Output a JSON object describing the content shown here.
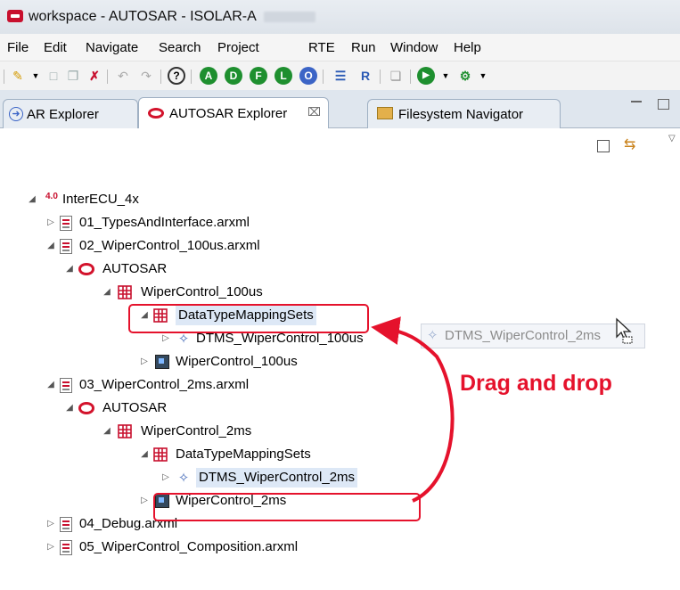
{
  "window": {
    "title": "workspace - AUTOSAR - ISOLAR-A"
  },
  "menu": [
    "File",
    "Edit",
    "Navigate",
    "Search",
    "Project",
    "RTE",
    "Run",
    "Window",
    "Help"
  ],
  "tabs": [
    {
      "label": "AR Explorer"
    },
    {
      "label": "AUTOSAR Explorer"
    },
    {
      "label": "Filesystem Navigator"
    }
  ],
  "toolbar_letters": [
    "A",
    "D",
    "F",
    "L",
    "O"
  ],
  "tree": [
    {
      "label": "InterECU_4x"
    },
    {
      "label": "01_TypesAndInterface.arxml"
    },
    {
      "label": "02_WiperControl_100us.arxml"
    },
    {
      "label": "AUTOSAR"
    },
    {
      "label": "WiperControl_100us"
    },
    {
      "label": "DataTypeMappingSets"
    },
    {
      "label": "DTMS_WiperControl_100us"
    },
    {
      "label": "WiperControl_100us"
    },
    {
      "label": "03_WiperControl_2ms.arxml"
    },
    {
      "label": "AUTOSAR"
    },
    {
      "label": "WiperControl_2ms"
    },
    {
      "label": "DataTypeMappingSets"
    },
    {
      "label": "DTMS_WiperControl_2ms"
    },
    {
      "label": "WiperControl_2ms"
    },
    {
      "label": "04_Debug.arxml"
    },
    {
      "label": "05_WiperControl_Composition.arxml"
    }
  ],
  "drag_ghost": {
    "label": "DTMS_WiperControl_2ms"
  },
  "annotation": {
    "text": "Drag and drop",
    "color": "#e5122c"
  },
  "colors": {
    "autosar_red": "#d3132c",
    "highlight_red": "#e5122c"
  }
}
